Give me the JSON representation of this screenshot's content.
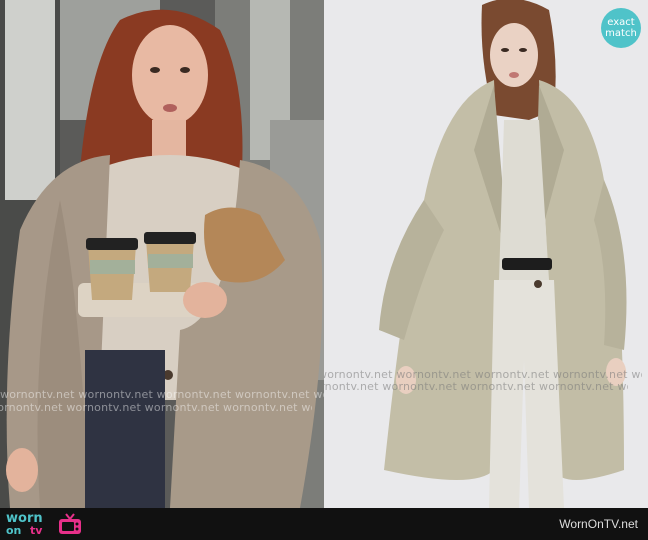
{
  "watermark": {
    "left_row": "wornontv.net   wornontv.net   wornontv.net   wornontv.net   wornontv.net",
    "right_row": "wornontv.net   wornontv.net   wornontv.net   wornontv.net   wornontv.net"
  },
  "badge": {
    "line1": "exact",
    "line2": "match"
  },
  "logo": {
    "worn": "worn",
    "on": "on",
    "tv": "tv"
  },
  "footer": {
    "site": "WornOnTV.net"
  },
  "colors": {
    "accent": "#4fc3c9",
    "logo_pink": "#e8308a",
    "footer_bg": "#111111"
  }
}
